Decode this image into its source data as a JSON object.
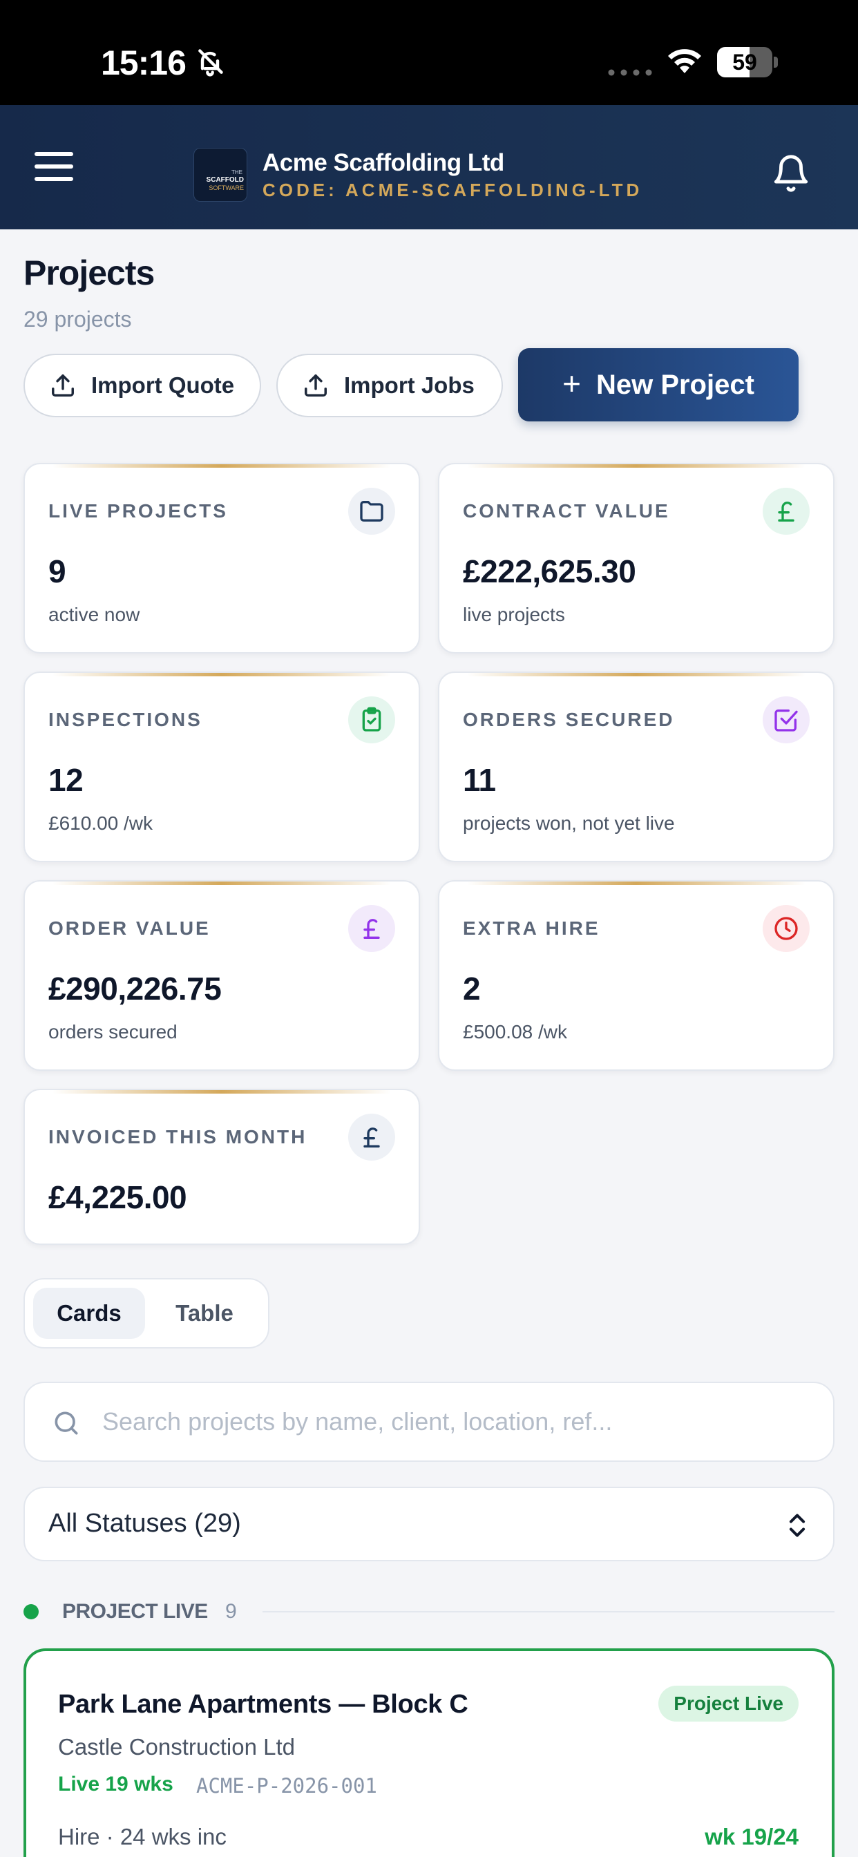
{
  "status_bar": {
    "time": "15:16",
    "battery": "59",
    "battery_level": 0.59,
    "icons": [
      "bell-slash-icon",
      "cellular-dots-icon",
      "wifi-icon",
      "battery-icon"
    ]
  },
  "header": {
    "company_name": "Acme Scaffolding Ltd",
    "company_code": "CODE: ACME-SCAFFOLDING-LTD",
    "logo_text": [
      "THE",
      "SCAFFOLD",
      "SOFTWARE"
    ],
    "accent_color": "#d4a85a",
    "background_color": "#1a3050"
  },
  "page": {
    "title": "Projects",
    "subtitle": "29 projects"
  },
  "actions": {
    "import_quote": "Import Quote",
    "import_jobs": "Import Jobs",
    "new_project": "New Project"
  },
  "stats": [
    {
      "label": "LIVE PROJECTS",
      "value": "9",
      "sub": "active now",
      "icon": "folder-icon",
      "color": "#1e3a5f"
    },
    {
      "label": "CONTRACT VALUE",
      "value": "£222,625.30",
      "sub": "live projects",
      "icon": "pound-icon",
      "color": "#16a34a"
    },
    {
      "label": "INSPECTIONS",
      "value": "12",
      "sub": "£610.00 /wk",
      "icon": "clipboard-check-icon",
      "color": "#16a34a"
    },
    {
      "label": "ORDERS SECURED",
      "value": "11",
      "sub": "projects won, not yet live",
      "icon": "checkbox-icon",
      "color": "#9333ea"
    },
    {
      "label": "ORDER VALUE",
      "value": "£290,226.75",
      "sub": "orders secured",
      "icon": "pound-icon",
      "color": "#9333ea"
    },
    {
      "label": "EXTRA HIRE",
      "value": "2",
      "sub": "£500.08 /wk",
      "icon": "clock-icon",
      "color": "#dc2626"
    },
    {
      "label": "INVOICED THIS MONTH",
      "value": "£4,225.00",
      "sub": "",
      "icon": "pound-icon",
      "color": "#1e3a5f"
    }
  ],
  "view_toggle": {
    "options": [
      "Cards",
      "Table"
    ],
    "selected": "Cards"
  },
  "search": {
    "placeholder": "Search projects by name, client, location, ref...",
    "value": ""
  },
  "status_filter": {
    "selected": "All Statuses (29)"
  },
  "groups": [
    {
      "label": "PROJECT LIVE",
      "count": "9",
      "color": "#16a34a",
      "projects": [
        {
          "name": "Park Lane Apartments — Block C",
          "badge": "Project Live",
          "client": "Castle Construction Ltd",
          "live": "Live 19 wks",
          "ref": "ACME-P-2026-001",
          "hire": "Hire · 24 wks inc",
          "week": "wk 19/24"
        }
      ]
    }
  ]
}
